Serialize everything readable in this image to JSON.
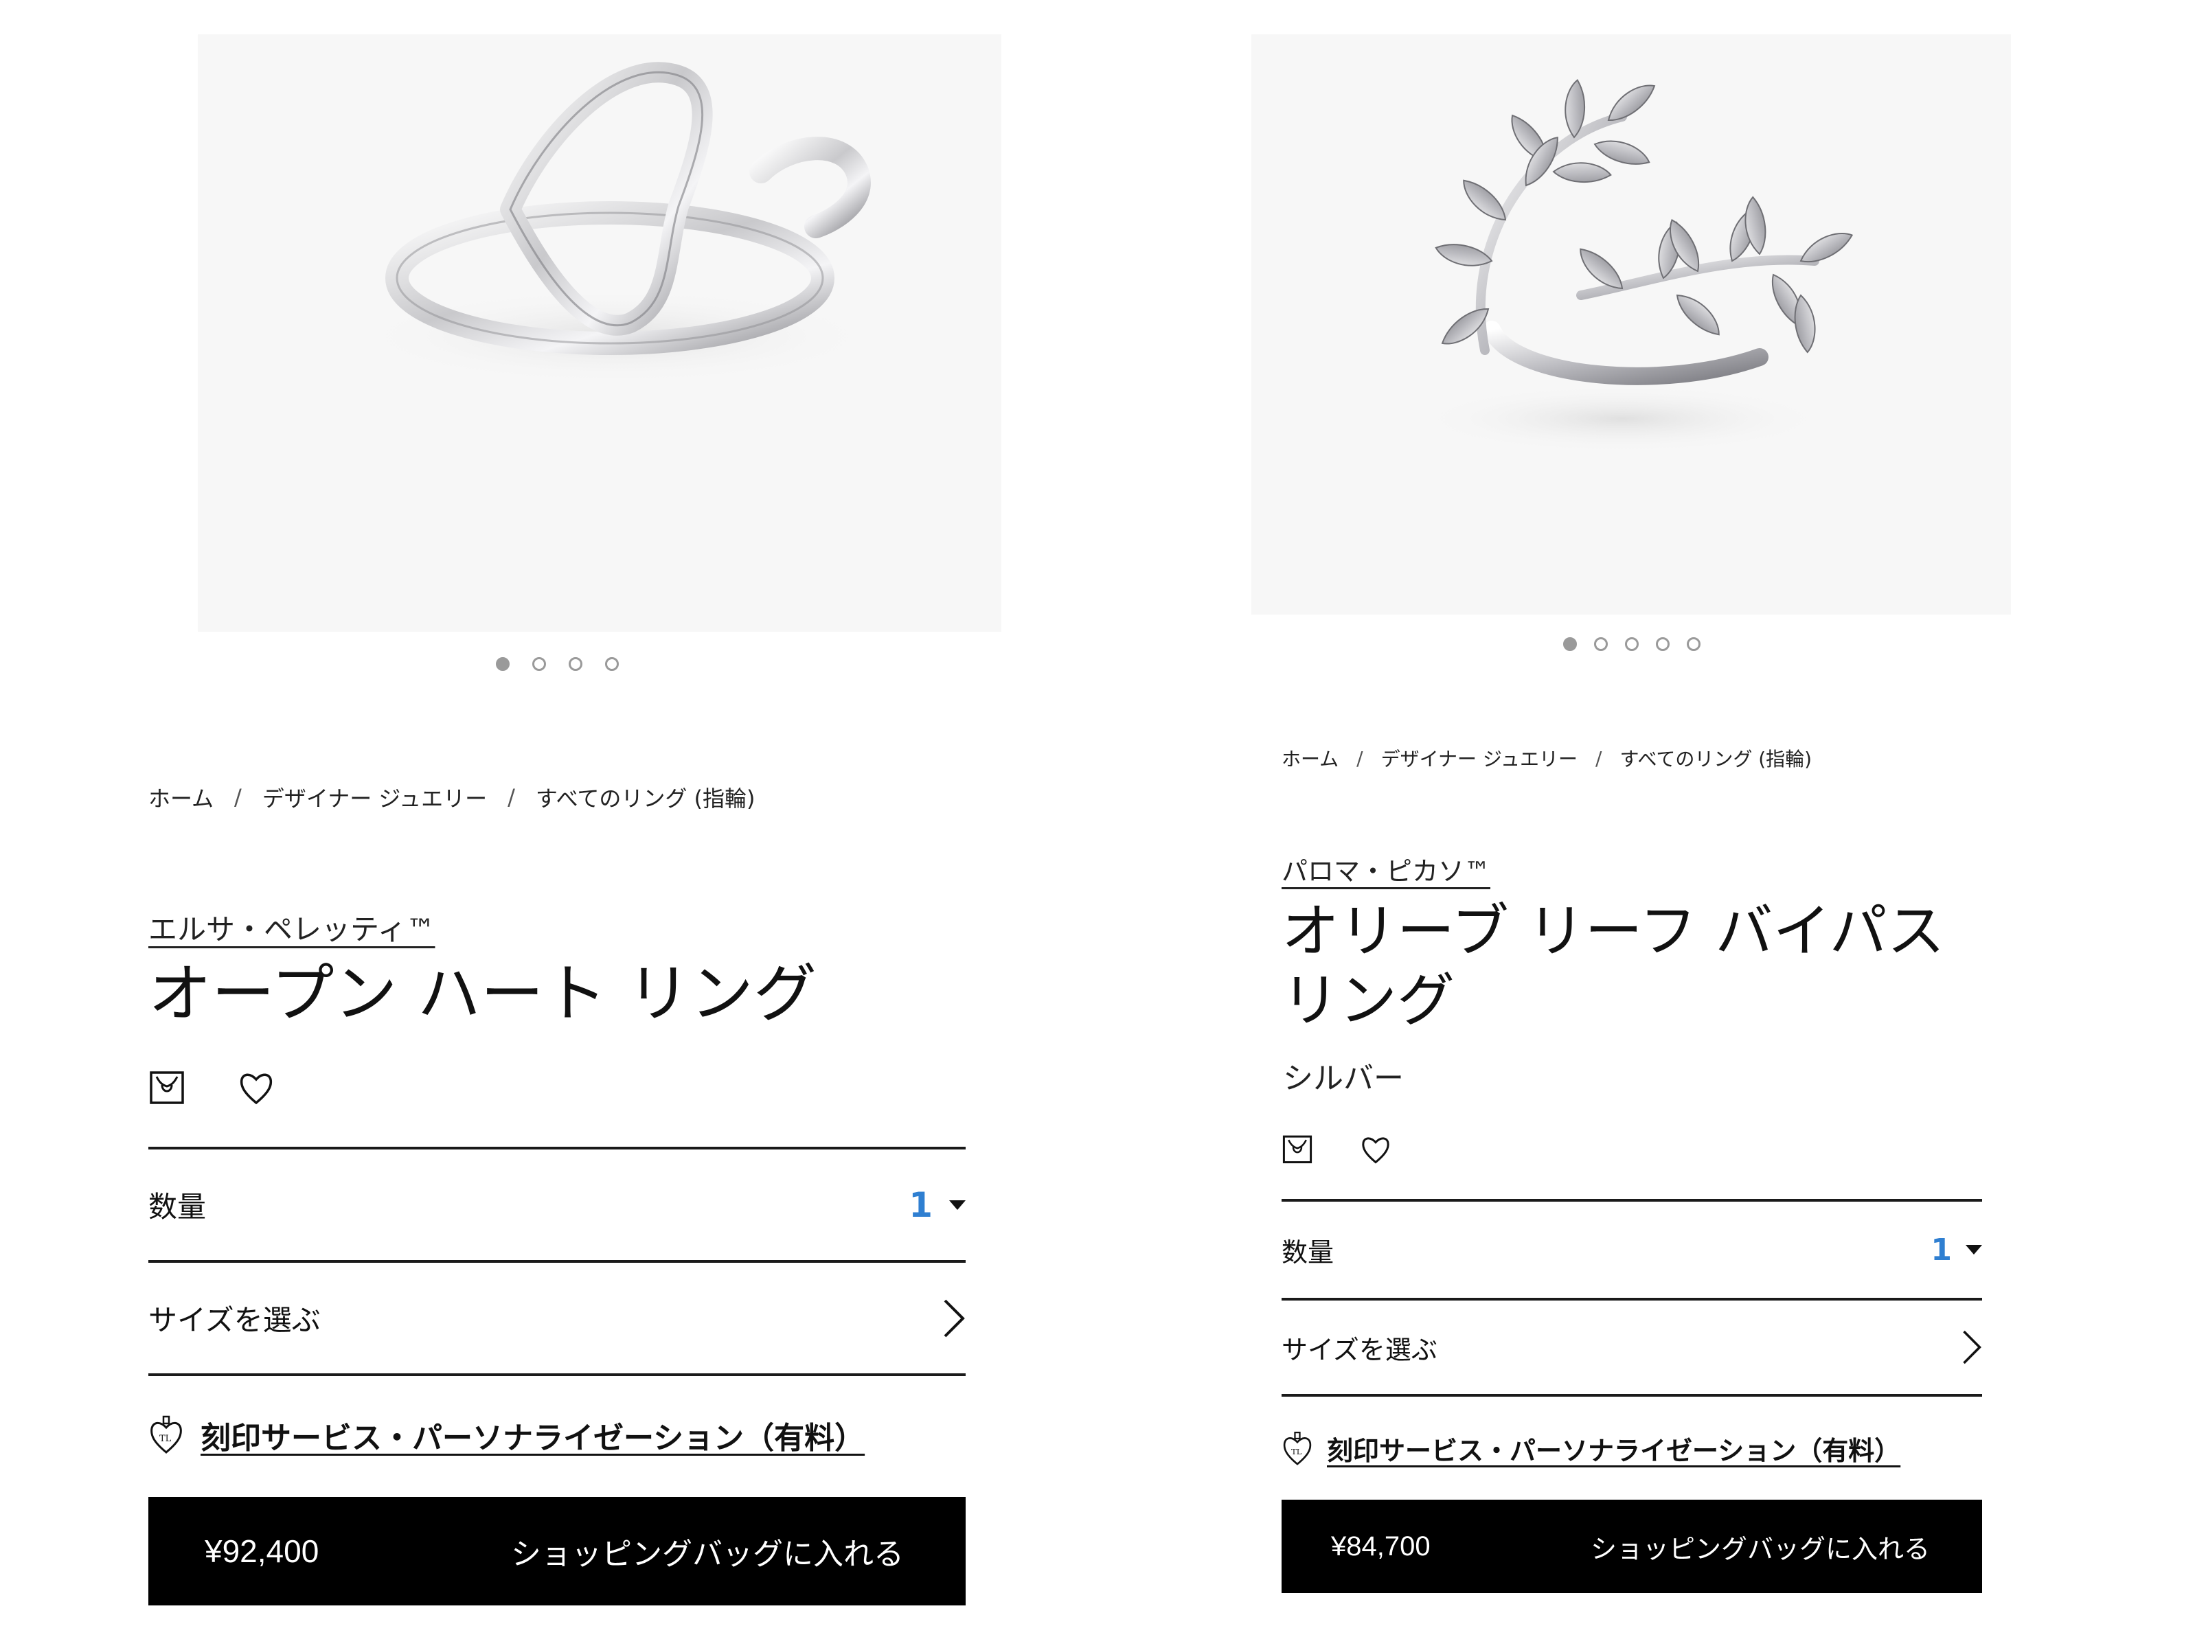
{
  "colors": {
    "accent_qty": "#2f7fd1",
    "button_bg": "#000000",
    "image_bg": "#f7f7f7"
  },
  "products": [
    {
      "breadcrumb": [
        "ホーム",
        "デザイナー ジュエリー",
        "すべてのリング (指輪)"
      ],
      "breadcrumb_sep": "/",
      "designer": "エルサ・ペレッティ™",
      "title": "オープン ハート リング",
      "subtitle": "",
      "gallery_dots": 4,
      "gallery_active": 1,
      "bag_icon": "shopping-bag-icon",
      "wishlist_icon": "heart-icon",
      "quantity_label": "数量",
      "quantity_value": "1",
      "size_label": "サイズを選ぶ",
      "engrave_icon": "engrave-heart-icon",
      "engrave_link": "刻印サービス・パーソナライゼーション（有料）",
      "price": "¥92,400",
      "cart_label": "ショッピングバッグに入れる"
    },
    {
      "breadcrumb": [
        "ホーム",
        "デザイナー ジュエリー",
        "すべてのリング (指輪)"
      ],
      "breadcrumb_sep": "/",
      "designer": "パロマ・ピカソ™",
      "title": "オリーブ リーフ バイパス リング",
      "subtitle": "シルバー",
      "gallery_dots": 5,
      "gallery_active": 1,
      "bag_icon": "shopping-bag-icon",
      "wishlist_icon": "heart-icon",
      "quantity_label": "数量",
      "quantity_value": "1",
      "size_label": "サイズを選ぶ",
      "engrave_icon": "engrave-heart-icon",
      "engrave_link": "刻印サービス・パーソナライゼーション（有料）",
      "price": "¥84,700",
      "cart_label": "ショッピングバッグに入れる"
    }
  ]
}
